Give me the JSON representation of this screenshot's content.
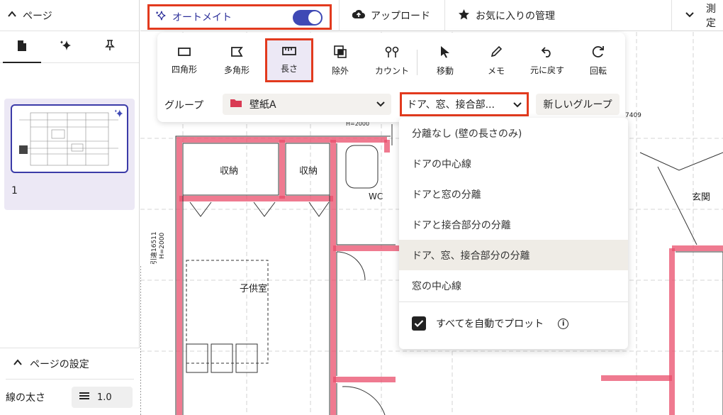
{
  "sidebar": {
    "pages_title": "ページ",
    "tabs": [
      {
        "name": "pages",
        "icon": "document-icon"
      },
      {
        "name": "ai",
        "icon": "sparkle-icon"
      },
      {
        "name": "pin",
        "icon": "pin-icon"
      }
    ],
    "page_number": "1",
    "settings_title": "ページの設定",
    "line_width_label": "線の太さ",
    "line_width_value": "1.0"
  },
  "topbar": {
    "automate_label": "オートメイト",
    "automate_enabled": true,
    "upload_label": "アップロード",
    "favorites_label": "お気に入りの管理",
    "measure_label": "測定"
  },
  "tools": {
    "items": [
      {
        "label": "四角形",
        "icon": "rectangle-icon"
      },
      {
        "label": "多角形",
        "icon": "polygon-icon"
      },
      {
        "label": "長さ",
        "icon": "ruler-icon",
        "active": true
      },
      {
        "label": "除外",
        "icon": "exclude-icon"
      },
      {
        "label": "カウント",
        "icon": "count-icon"
      },
      {
        "label": "移動",
        "icon": "cursor-icon"
      },
      {
        "label": "メモ",
        "icon": "pen-icon"
      },
      {
        "label": "元に戻す",
        "icon": "undo-icon"
      },
      {
        "label": "回転",
        "icon": "rotate-icon"
      }
    ],
    "group_label": "グループ",
    "group_value": "壁紙A",
    "mode_value": "ドア、窓、接合部...",
    "new_group_label": "新しいグループ"
  },
  "dropdown": {
    "options": [
      "分離なし (壁の長さのみ)",
      "ドアの中心線",
      "ドアと窓の分離",
      "ドアと接合部分の分離",
      "ドア、窓、接合部分の分離",
      "窓の中心線"
    ],
    "selected_index": 4,
    "auto_plot_label": "すべてを自動でプロット",
    "auto_plot_checked": true
  },
  "floorplan": {
    "labels": [
      "収納",
      "収納",
      "WC",
      "玄関",
      "子供室",
      "引違16511",
      "H=2000",
      "H=2000",
      "7409"
    ]
  },
  "colors": {
    "accent": "#3f49b5",
    "highlight_border": "#e23a1e",
    "wall_highlight": "#ea4d6b",
    "selected_bg": "#ece8f5"
  }
}
